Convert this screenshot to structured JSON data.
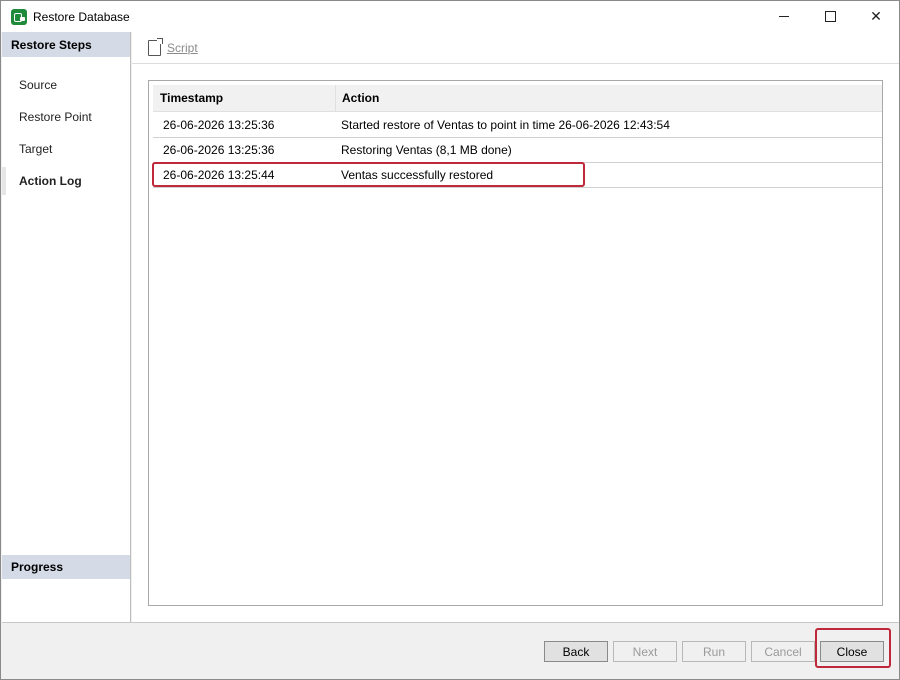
{
  "window": {
    "title": "Restore Database",
    "controls": {
      "minimize": "",
      "maximize": "",
      "close": "✕"
    }
  },
  "sidebar": {
    "header": "Restore Steps",
    "items": [
      {
        "label": "Source"
      },
      {
        "label": "Restore Point"
      },
      {
        "label": "Target"
      },
      {
        "label": "Action Log"
      }
    ],
    "active_item": "Action Log",
    "progress_header": "Progress"
  },
  "toolbar": {
    "script_label": "Script"
  },
  "log": {
    "columns": {
      "timestamp": "Timestamp",
      "action": "Action"
    },
    "rows": [
      {
        "timestamp": "26-06-2026 13:25:36",
        "action": "Started restore of Ventas to point in time 26-06-2026 12:43:54"
      },
      {
        "timestamp": "26-06-2026 13:25:36",
        "action": "Restoring Ventas (8,1 MB done)"
      },
      {
        "timestamp": "26-06-2026 13:25:44",
        "action": "Ventas successfully restored"
      }
    ]
  },
  "footer": {
    "back_label": "Back",
    "next_label": "Next",
    "run_label": "Run",
    "cancel_label": "Cancel",
    "close_label": "Close"
  },
  "colors": {
    "highlight": "#c0283c",
    "sidebar_header_bg": "#d4dae6",
    "app_icon": "#1e8a3a"
  }
}
